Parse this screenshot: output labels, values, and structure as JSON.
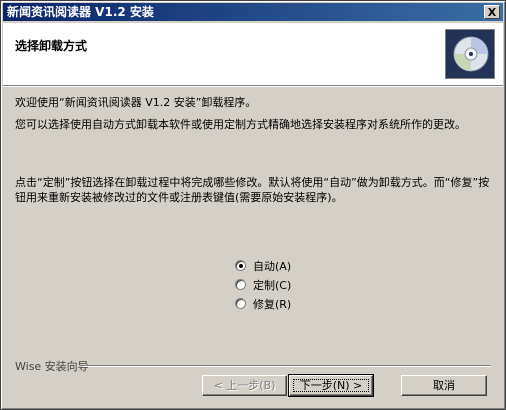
{
  "window": {
    "title": "新闻资讯阅读器 V1.2 安装",
    "close_label": "X"
  },
  "header": {
    "title": "选择卸载方式",
    "icon": "cd-disc-icon"
  },
  "content": {
    "welcome": "欢迎使用“新闻资讯阅读器 V1.2 安装”卸载程序。",
    "description": "您可以选择使用自动方式卸载本软件或使用定制方式精确地选择安装程序对系统所作的更改。",
    "instructions": "点击“定制”按钮选择在卸载过程中将完成哪些修改。默认将使用“自动”做为卸载方式。而“修复”按钮用来重新安装被修改过的文件或注册表键值(需要原始安装程序)。"
  },
  "options": [
    {
      "label": "自动(A)",
      "checked": true
    },
    {
      "label": "定制(C)",
      "checked": false
    },
    {
      "label": "修复(R)",
      "checked": false
    }
  ],
  "footer": {
    "brand": "Wise 安装向导",
    "back_label": "< 上一步(B)",
    "next_label": "下一步(N) >",
    "cancel_label": "取消"
  }
}
